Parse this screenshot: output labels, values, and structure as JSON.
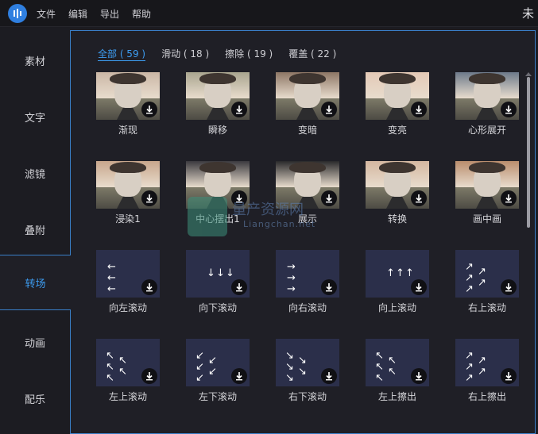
{
  "titlebar": {
    "menu": [
      "文件",
      "编辑",
      "导出",
      "帮助"
    ],
    "title": "未"
  },
  "sidebar": {
    "items": [
      {
        "label": "素材",
        "active": false
      },
      {
        "label": "文字",
        "active": false
      },
      {
        "label": "滤镜",
        "active": false
      },
      {
        "label": "叠附",
        "active": false
      },
      {
        "label": "转场",
        "active": true
      },
      {
        "label": "动画",
        "active": false
      },
      {
        "label": "配乐",
        "active": false
      }
    ]
  },
  "tabs": [
    {
      "label": "全部 ( 59 )",
      "active": true
    },
    {
      "label": "滑动 ( 18 )",
      "active": false
    },
    {
      "label": "擦除 ( 19 )",
      "active": false
    },
    {
      "label": "覆盖 ( 22 )",
      "active": false
    }
  ],
  "transitions": [
    {
      "label": "渐现",
      "kind": "photo"
    },
    {
      "label": "瞬移",
      "kind": "photo"
    },
    {
      "label": "变暗",
      "kind": "photo"
    },
    {
      "label": "变亮",
      "kind": "photo"
    },
    {
      "label": "心形展开",
      "kind": "photo"
    },
    {
      "label": "浸染1",
      "kind": "photo"
    },
    {
      "label": "中心摆出1",
      "kind": "photo"
    },
    {
      "label": "展示",
      "kind": "photo"
    },
    {
      "label": "转换",
      "kind": "photo"
    },
    {
      "label": "画中画",
      "kind": "photo"
    },
    {
      "label": "向左滚动",
      "kind": "arrows",
      "arrow": "←"
    },
    {
      "label": "向下滚动",
      "kind": "arrows",
      "arrow": "↓"
    },
    {
      "label": "向右滚动",
      "kind": "arrows",
      "arrow": "→"
    },
    {
      "label": "向上滚动",
      "kind": "arrows",
      "arrow": "↑"
    },
    {
      "label": "右上滚动",
      "kind": "arrows",
      "arrow": "↗"
    },
    {
      "label": "左上滚动",
      "kind": "arrows",
      "arrow": "↖"
    },
    {
      "label": "左下滚动",
      "kind": "arrows",
      "arrow": "↙"
    },
    {
      "label": "右下滚动",
      "kind": "arrows",
      "arrow": "↘"
    },
    {
      "label": "左上擦出",
      "kind": "arrows",
      "arrow": "↖"
    },
    {
      "label": "右上擦出",
      "kind": "arrows",
      "arrow": "↗"
    }
  ],
  "watermark": {
    "text": "量产资源网",
    "sub": "Liangchan.net"
  },
  "icons": {
    "download": "download-icon",
    "logo": "app-logo-icon"
  },
  "colors": {
    "accent": "#3d9df2",
    "panel_border": "#3a7fc8",
    "background": "#1c1c22",
    "tile_bg": "#2b2f4a"
  }
}
